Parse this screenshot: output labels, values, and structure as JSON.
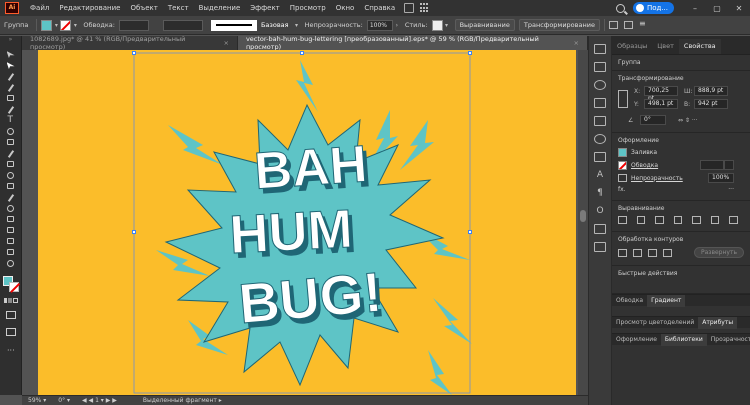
{
  "app": {
    "logo_text": "Ai"
  },
  "menu": {
    "items": [
      "Файл",
      "Редактирование",
      "Объект",
      "Текст",
      "Выделение",
      "Эффект",
      "Просмотр",
      "Окно",
      "Справка"
    ],
    "share_label": "Под..."
  },
  "control_bar": {
    "group_label": "Группа",
    "stroke_label": "Обводка:",
    "basic_label": "Базовая",
    "opacity_label": "Непрозрачность:",
    "opacity_value": "100%",
    "style_label": "Стиль:",
    "align_btn": "Выравнивание",
    "transform_btn": "Трансформирование",
    "fill_color": "#5ec4c6"
  },
  "tabs": [
    {
      "label": "1082689.jpg* @ 41 % (RGB/Предварительный просмотр)",
      "close": "×"
    },
    {
      "label": "vector-bah-hum-bug-lettering [преобразованный].eps* @ 59 % (RGB/Предварительный просмотр)",
      "close": "×"
    }
  ],
  "artwork": {
    "line1": "BAH",
    "line2": "HUM",
    "line3": "BUG!",
    "bg_color": "#fbbd2a",
    "burst_color": "#5ec4c6",
    "shadow_color": "#1f6675"
  },
  "status": {
    "zoom": "59%",
    "rotation": "0°",
    "page": "1",
    "mode": "Выделенный фрагмент"
  },
  "panel": {
    "tabs": [
      "Образцы",
      "Цвет",
      "Свойства"
    ],
    "group_title": "Группа",
    "transform_title": "Трансформирование",
    "x_label": "X:",
    "x_value": "700,25 pt",
    "y_label": "Y:",
    "y_value": "498,1 pt",
    "w_label": "Ш:",
    "w_value": "888,9 pt",
    "h_label": "В:",
    "h_value": "942 pt",
    "angle_value": "0°",
    "appearance_title": "Оформление",
    "fill_label": "Заливка",
    "stroke_label": "Обводка",
    "opacity_label": "Непрозрачность",
    "opacity_value": "100%",
    "fx_label": "fx.",
    "align_title": "Выравнивание",
    "pathfinder_title": "Обработка контуров",
    "expand_btn": "Развернуть",
    "quick_title": "Быстрые действия",
    "bottom_tabs1": [
      "Обводка",
      "Градиент"
    ],
    "bottom_tabs2": [
      "Просмотр цветоделений",
      "Атрибуты"
    ],
    "bottom_tabs3": [
      "Оформление",
      "Библиотеки",
      "Прозрачность"
    ]
  }
}
